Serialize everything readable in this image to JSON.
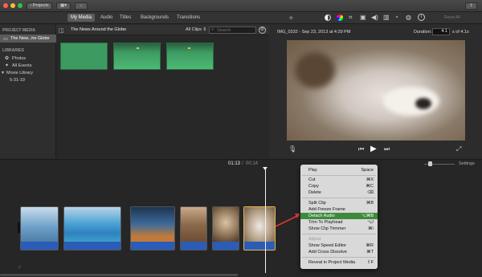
{
  "titlebar": {
    "back_button": "Projects",
    "lights": [
      "#ff5f57",
      "#febc2e",
      "#28c840"
    ]
  },
  "tabs": [
    {
      "label": "My Media",
      "active": true
    },
    {
      "label": "Audio",
      "active": false
    },
    {
      "label": "Titles",
      "active": false
    },
    {
      "label": "Backgrounds",
      "active": false
    },
    {
      "label": "Transitions",
      "active": false
    }
  ],
  "viewer_toolbar": {
    "reset_all": "Reset All"
  },
  "sidebar": {
    "project_media_header": "PROJECT MEDIA",
    "project_item": "The New...he Globe",
    "libraries_header": "LIBRARIES",
    "items": [
      {
        "label": "Photos"
      },
      {
        "label": "All Events"
      },
      {
        "label": "Movie Library"
      },
      {
        "label": "5-31-19"
      }
    ]
  },
  "browser": {
    "title": "The News Around the Globe",
    "filter": "All Clips",
    "search_placeholder": "Search"
  },
  "viewer": {
    "clip_name": "IMG_0332 - Sep 23, 2013 at 4:39 PM",
    "duration_label": "Duration:",
    "duration_value": "4.1",
    "duration_total": "s of 4.1s"
  },
  "timeline": {
    "current_time": "01:13",
    "separator": "/",
    "total_time": "00:14",
    "settings_label": "Settings"
  },
  "context_menu": {
    "groups": [
      [
        {
          "label": "Play",
          "shortcut": "Space"
        }
      ],
      [
        {
          "label": "Cut",
          "shortcut": "⌘X"
        },
        {
          "label": "Copy",
          "shortcut": "⌘C"
        },
        {
          "label": "Delete",
          "shortcut": "⌫"
        }
      ],
      [
        {
          "label": "Split Clip",
          "shortcut": "⌘B"
        },
        {
          "label": "Add Freeze Frame",
          "shortcut": ""
        },
        {
          "label": "Detach Audio",
          "shortcut": "⌥⌘B",
          "selected": true
        },
        {
          "label": "Trim To Playhead",
          "shortcut": "⌥/"
        },
        {
          "label": "Show Clip Trimmer",
          "shortcut": "⌘\\"
        }
      ],
      [
        {
          "label": "Adjust",
          "shortcut": "",
          "disabled": true
        },
        {
          "label": "Show Speed Editor",
          "shortcut": "⌘R"
        },
        {
          "label": "Add Cross Dissolve",
          "shortcut": "⌘T"
        }
      ],
      [
        {
          "label": "Reveal in Project Media",
          "shortcut": "⇧F"
        }
      ]
    ]
  },
  "colors": {
    "accent_green": "#3d8a3d",
    "clip_audio_blue": "#2b5cb8",
    "thumb_green": "#3d9b62",
    "arrow_red": "#e03535"
  }
}
